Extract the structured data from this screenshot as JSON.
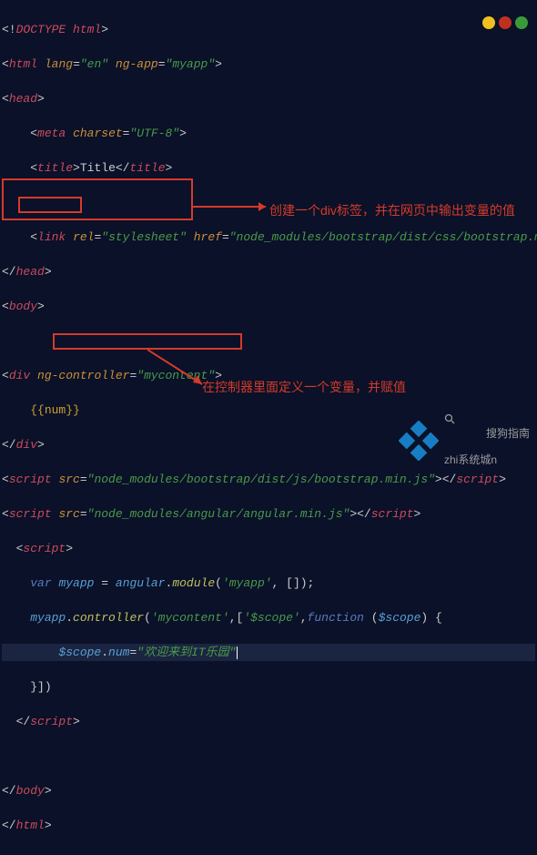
{
  "code": {
    "doctype": "DOCTYPE html",
    "html_tag": "html",
    "lang_attr": "lang",
    "lang_val": "\"en\"",
    "ngapp_attr": "ng-app",
    "ngapp_val": "\"myapp\"",
    "head_tag": "head",
    "meta_tag": "meta",
    "charset_attr": "charset",
    "charset_val": "\"UTF-8\"",
    "title_tag": "title",
    "title_text": "Title",
    "link_tag": "link",
    "rel_attr": "rel",
    "rel_val": "\"stylesheet\"",
    "href_attr": "href",
    "href_val": "\"node_modules/bootstrap/dist/css/bootstrap.min.css\"",
    "body_tag": "body",
    "div_tag": "div",
    "ngctrl_attr": "ng-controller",
    "ngctrl_val": "\"mycontent\"",
    "mustache_open": "{{",
    "mustache_var": "num",
    "mustache_close": "}}",
    "script_tag": "script",
    "src_attr": "src",
    "src1_val": "\"node_modules/bootstrap/dist/js/bootstrap.min.js\"",
    "src2_val": "\"node_modules/angular/angular.min.js\"",
    "var_kw": "var",
    "myapp_ident": "myapp",
    "angular_ident": "angular",
    "module_fn": "module",
    "myapp_str": "'myapp'",
    "controller_fn": "controller",
    "mycontent_str": "'mycontent'",
    "scope_str": "'$scope'",
    "function_kw": "function",
    "scope_param": "$scope",
    "scope_ident": "$scope",
    "num_prop": "num",
    "num_val": "\"欢迎来到IT乐园\""
  },
  "annotations": {
    "a1": "创建一个div标签，并在网页中输出变量的值",
    "a2": "在控制器里面定义一个变量，并赋值"
  },
  "watermark": {
    "line1": "搜狗指南",
    "line2": "zhi系统城n"
  },
  "icons": {
    "chrome_color": "#f0c020",
    "opera_color": "#c03020",
    "green_color": "#3a9a3a"
  }
}
